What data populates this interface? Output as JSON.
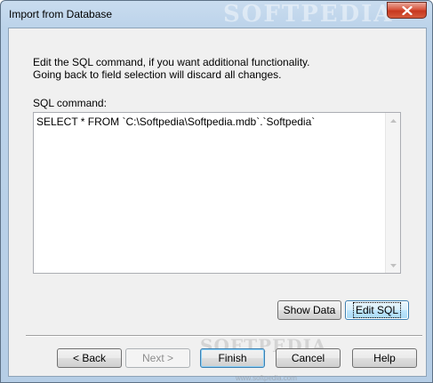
{
  "window": {
    "title": "Import from Database",
    "watermark": "SOFTPEDIA",
    "close_icon": "close-icon"
  },
  "content": {
    "description_line1": "Edit the SQL command, if you want additional functionality.",
    "description_line2": "Going back to field selection will discard all changes.",
    "sql_label": "SQL command:",
    "sql_value": "SELECT * FROM `C:\\Softpedia\\Softpedia.mdb`.`Softpedia`"
  },
  "actions": {
    "show_data": "Show Data",
    "edit_sql": "Edit SQL"
  },
  "footer": {
    "back": "< Back",
    "next": "Next >",
    "finish": "Finish",
    "cancel": "Cancel",
    "help": "Help",
    "watermark": "SOFTPEDIA",
    "watermark_url": "www.softpedia.com"
  },
  "colors": {
    "frame": "#bcd3ea",
    "close_button": "#c7381f",
    "focus_border": "#3c7fb1"
  }
}
